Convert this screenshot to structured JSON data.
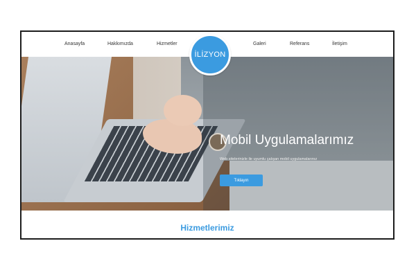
{
  "nav": {
    "items": [
      {
        "label": "Anasayfa"
      },
      {
        "label": "Hakkımızda"
      },
      {
        "label": "Hizmetler"
      },
      {
        "label": "Galeri"
      },
      {
        "label": "Referans"
      },
      {
        "label": "İletişim"
      }
    ]
  },
  "logo": {
    "text": "İLİZYON"
  },
  "hero": {
    "title": "Mobil Uygulamalarımız",
    "subtitle": "Web sitelerinizle ile uyumlu çalışan mobil uygulamalarınız",
    "button_label": "Tıklayın"
  },
  "services": {
    "title": "Hizmetlerimiz"
  },
  "colors": {
    "accent": "#3b9be0",
    "frame_border": "#1c1c1c",
    "text": "#333333"
  }
}
